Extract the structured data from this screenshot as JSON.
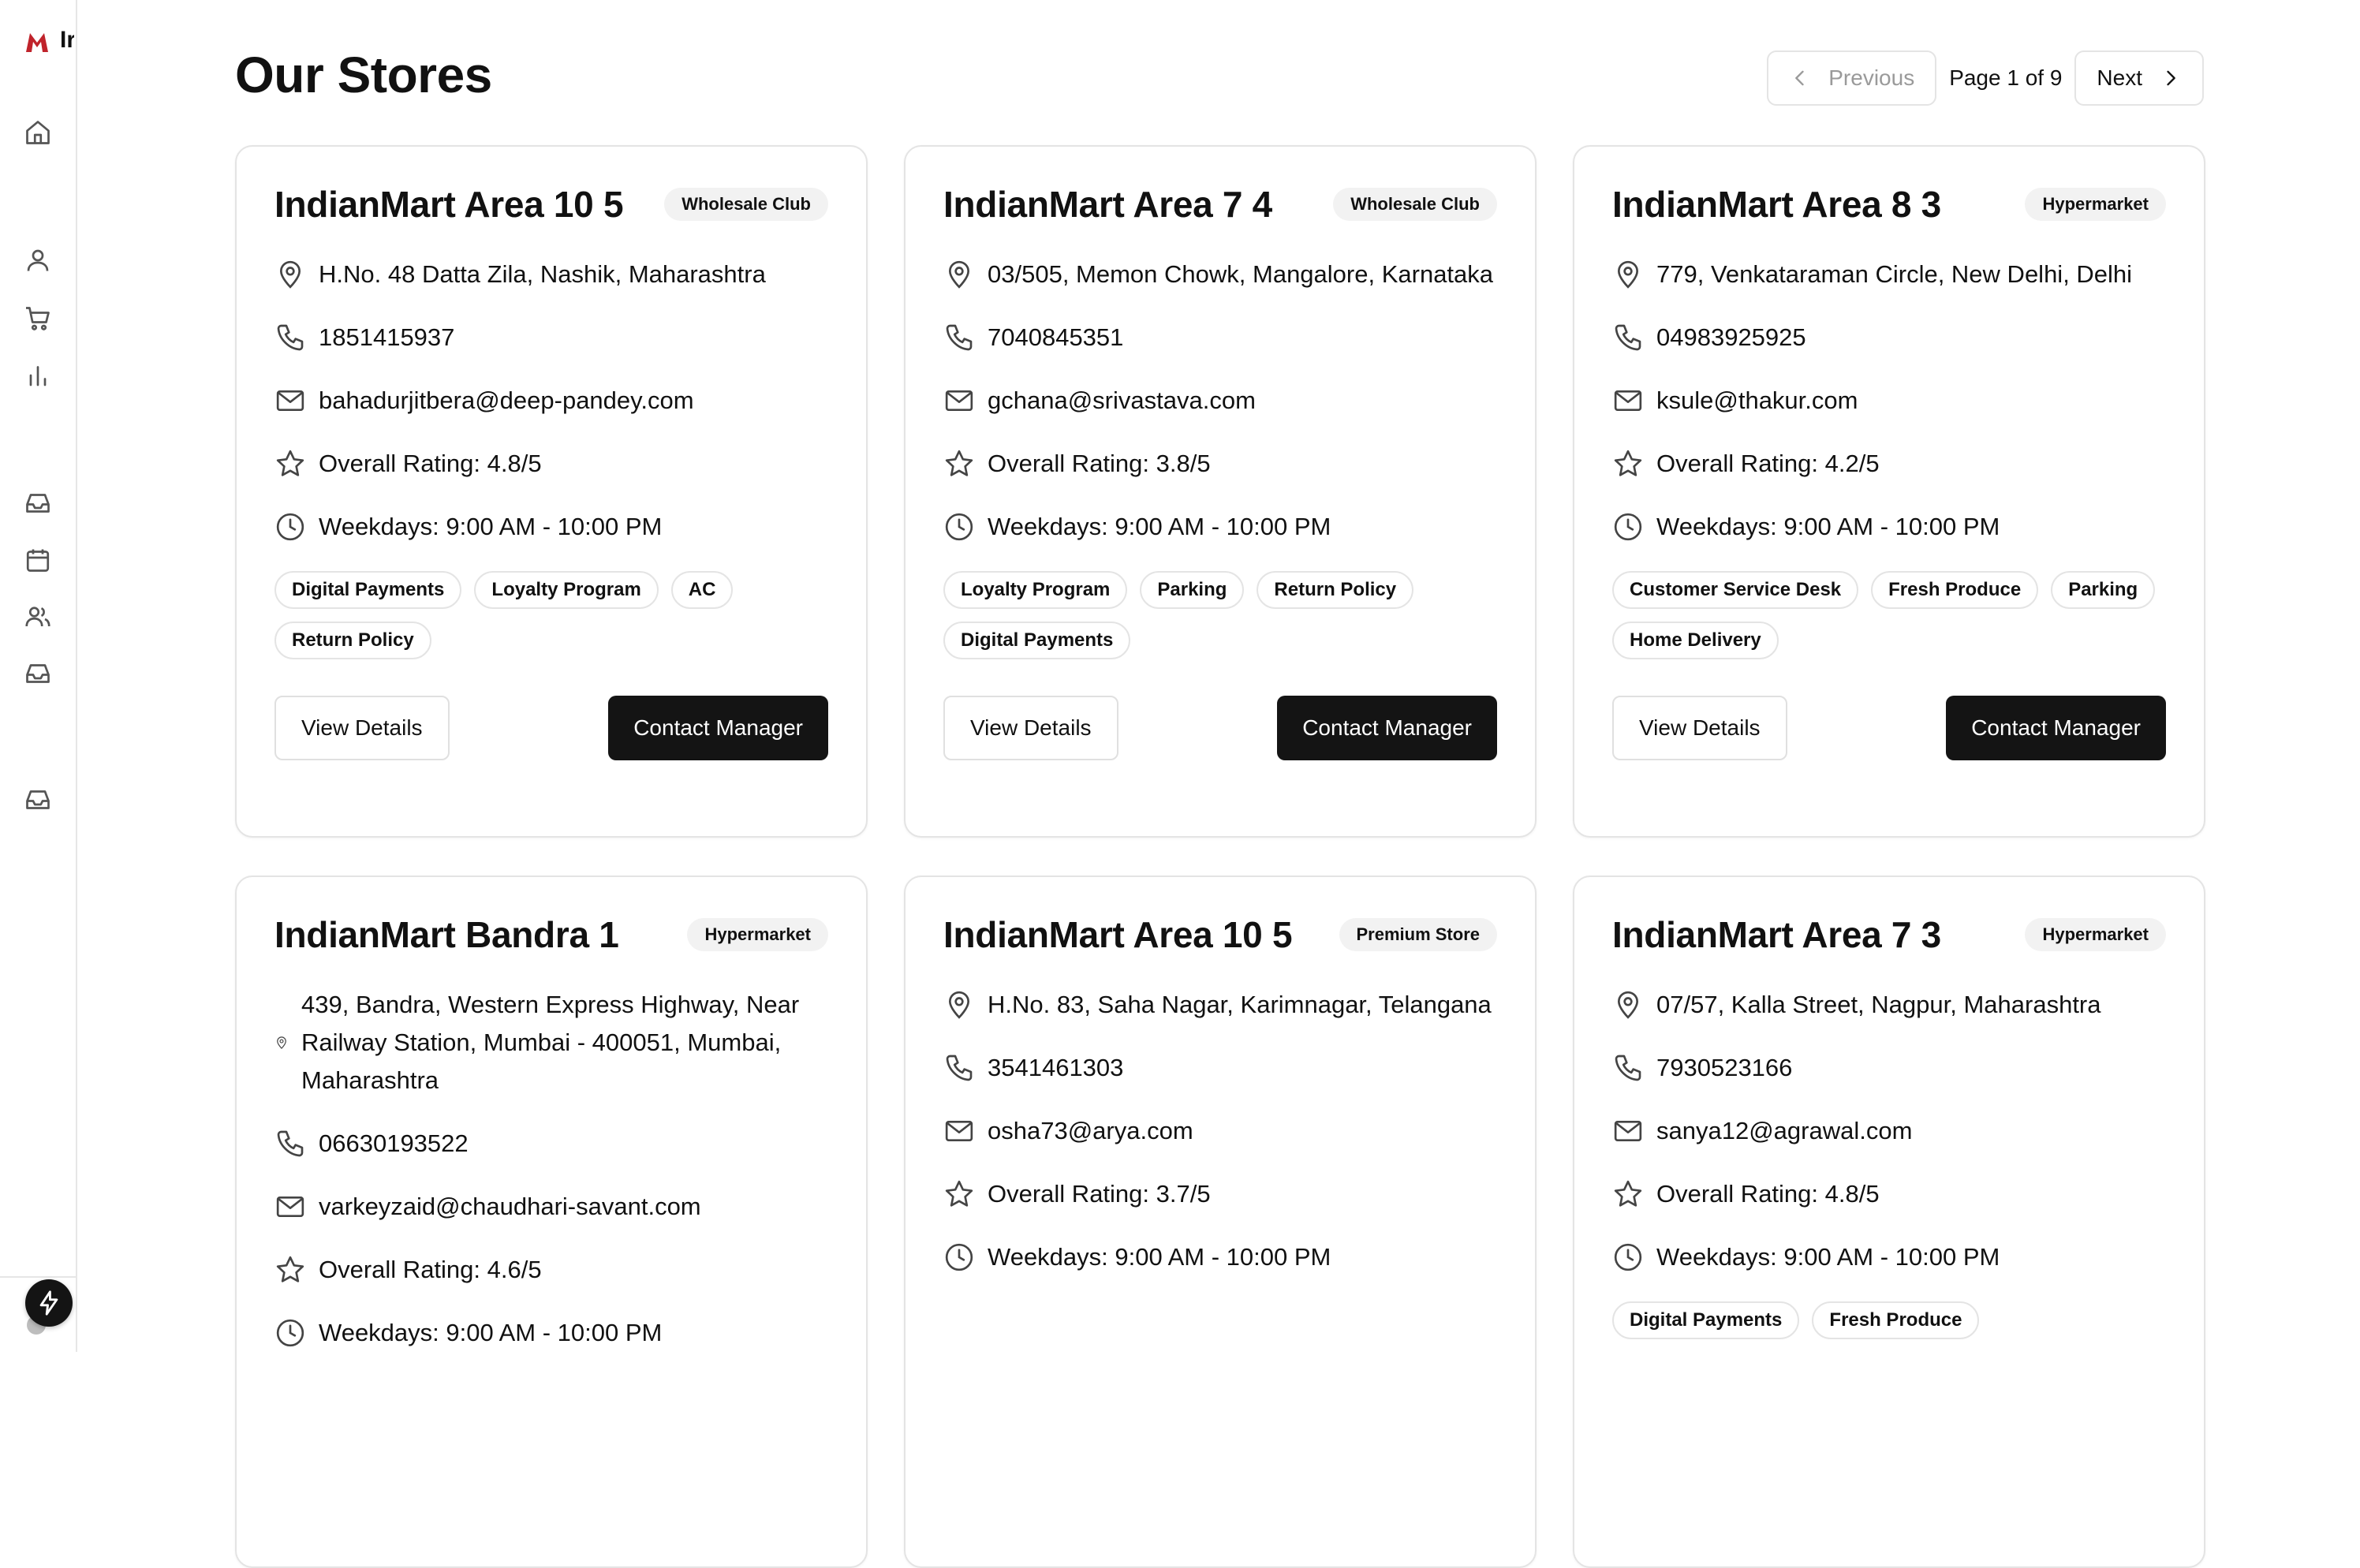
{
  "app": {
    "brand_initial": "Ir"
  },
  "page": {
    "title": "Our Stores"
  },
  "pagination": {
    "previous_label": "Previous",
    "page_info": "Page 1 of 9",
    "next_label": "Next"
  },
  "sidebar": {
    "icons": [
      "home-icon",
      "user-icon",
      "cart-icon",
      "chart-icon",
      "inbox-icon",
      "calendar-icon",
      "users-icon",
      "inbox-icon",
      "inbox-icon"
    ]
  },
  "stores": [
    {
      "name": "IndianMart Area 10 5",
      "type": "Wholesale Club",
      "address": "H.No. 48 Datta Zila, Nashik, Maharashtra",
      "phone": "1851415937",
      "email": "bahadurjitbera@deep-pandey.com",
      "rating": "Overall Rating: 4.8/5",
      "hours": "Weekdays: 9:00 AM - 10:00 PM",
      "features": [
        "Digital Payments",
        "Loyalty Program",
        "AC",
        "Return Policy"
      ],
      "view_label": "View Details",
      "contact_label": "Contact Manager"
    },
    {
      "name": "IndianMart Area 7 4",
      "type": "Wholesale Club",
      "address": "03/505, Memon Chowk, Mangalore, Karnataka",
      "phone": "7040845351",
      "email": "gchana@srivastava.com",
      "rating": "Overall Rating: 3.8/5",
      "hours": "Weekdays: 9:00 AM - 10:00 PM",
      "features": [
        "Loyalty Program",
        "Parking",
        "Return Policy",
        "Digital Payments"
      ],
      "view_label": "View Details",
      "contact_label": "Contact Manager"
    },
    {
      "name": "IndianMart Area 8 3",
      "type": "Hypermarket",
      "address": "779, Venkataraman Circle, New Delhi, Delhi",
      "phone": "04983925925",
      "email": "ksule@thakur.com",
      "rating": "Overall Rating: 4.2/5",
      "hours": "Weekdays: 9:00 AM - 10:00 PM",
      "features": [
        "Customer Service Desk",
        "Fresh Produce",
        "Parking",
        "Home Delivery"
      ],
      "view_label": "View Details",
      "contact_label": "Contact Manager"
    },
    {
      "name": "IndianMart Bandra 1",
      "type": "Hypermarket",
      "address": "439, Bandra, Western Express Highway, Near Railway Station, Mumbai - 400051, Mumbai, Maharashtra",
      "phone": "06630193522",
      "email": "varkeyzaid@chaudhari-savant.com",
      "rating": "Overall Rating: 4.6/5",
      "hours": "Weekdays: 9:00 AM - 10:00 PM",
      "features": [],
      "view_label": "",
      "contact_label": ""
    },
    {
      "name": "IndianMart Area 10 5",
      "type": "Premium Store",
      "address": "H.No. 83, Saha Nagar, Karimnagar, Telangana",
      "phone": "3541461303",
      "email": "osha73@arya.com",
      "rating": "Overall Rating: 3.7/5",
      "hours": "Weekdays: 9:00 AM - 10:00 PM",
      "features": [],
      "view_label": "",
      "contact_label": ""
    },
    {
      "name": "IndianMart Area 7 3",
      "type": "Hypermarket",
      "address": "07/57, Kalla Street, Nagpur, Maharashtra",
      "phone": "7930523166",
      "email": "sanya12@agrawal.com",
      "rating": "Overall Rating: 4.8/5",
      "hours": "Weekdays: 9:00 AM - 10:00 PM",
      "features": [
        "Digital Payments",
        "Fresh Produce"
      ],
      "view_label": "",
      "contact_label": ""
    }
  ]
}
